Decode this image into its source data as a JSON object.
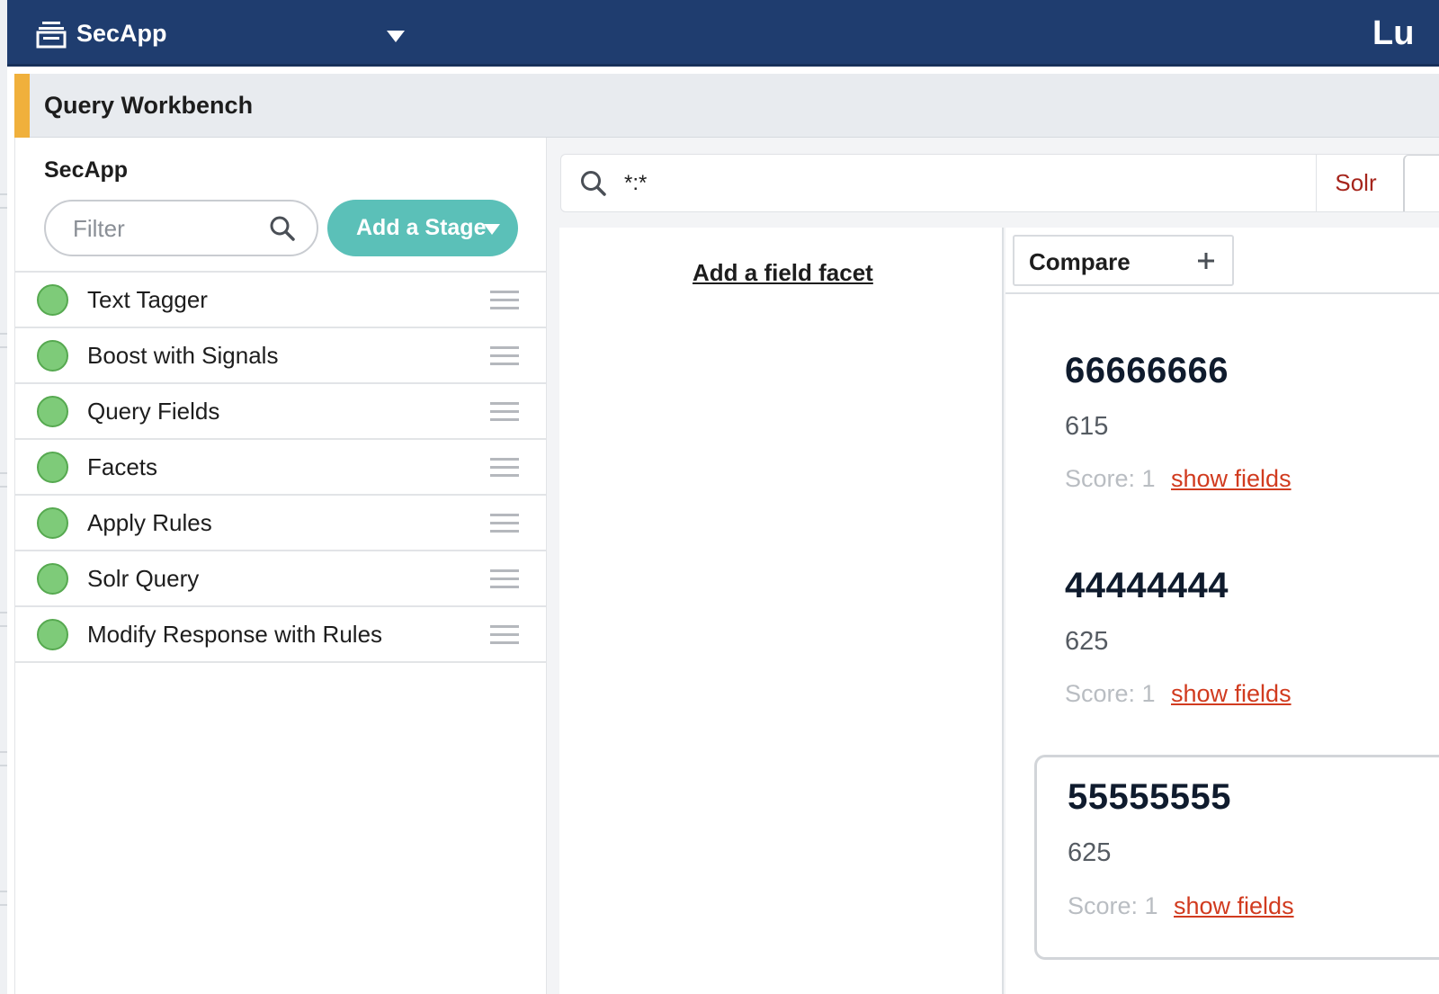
{
  "topbar": {
    "app_name": "SecApp",
    "right_text": "Lu"
  },
  "page": {
    "title": "Query Workbench"
  },
  "pipeline": {
    "title": "SecApp",
    "filter_placeholder": "Filter",
    "add_stage_label": "Add a Stage",
    "stages": [
      {
        "label": "Text Tagger"
      },
      {
        "label": "Boost with Signals"
      },
      {
        "label": "Query Fields"
      },
      {
        "label": "Facets"
      },
      {
        "label": "Apply Rules"
      },
      {
        "label": "Solr Query"
      },
      {
        "label": "Modify Response with Rules"
      }
    ]
  },
  "query": {
    "value": "*:*",
    "solr_label": "Solr"
  },
  "facets": {
    "add_facet_label": "Add a field facet"
  },
  "results": {
    "compare_label": "Compare",
    "items": [
      {
        "id": "66666666",
        "value": "615",
        "score": "Score: 1",
        "link": "show fields"
      },
      {
        "id": "44444444",
        "value": "625",
        "score": "Score: 1",
        "link": "show fields"
      },
      {
        "id": "55555555",
        "value": "625",
        "score": "Score: 1",
        "link": "show fields"
      }
    ]
  },
  "colors": {
    "topbar": "#1f3d6f",
    "header_accent": "#f0b03c",
    "add_stage_button": "#5bc0b8",
    "stage_enabled": "#7ecb79",
    "link": "#d13b1f",
    "solr_text": "#a5241b"
  },
  "icons": {
    "app": "stacked-tray-icon",
    "app_dropdown": "triangle-down-icon",
    "filter_search": "search-icon",
    "add_stage_caret": "triangle-down-icon",
    "stage_status": "circle-status-icon",
    "drag": "drag-handle-icon",
    "query_search": "search-icon",
    "compare_add": "plus-icon"
  }
}
